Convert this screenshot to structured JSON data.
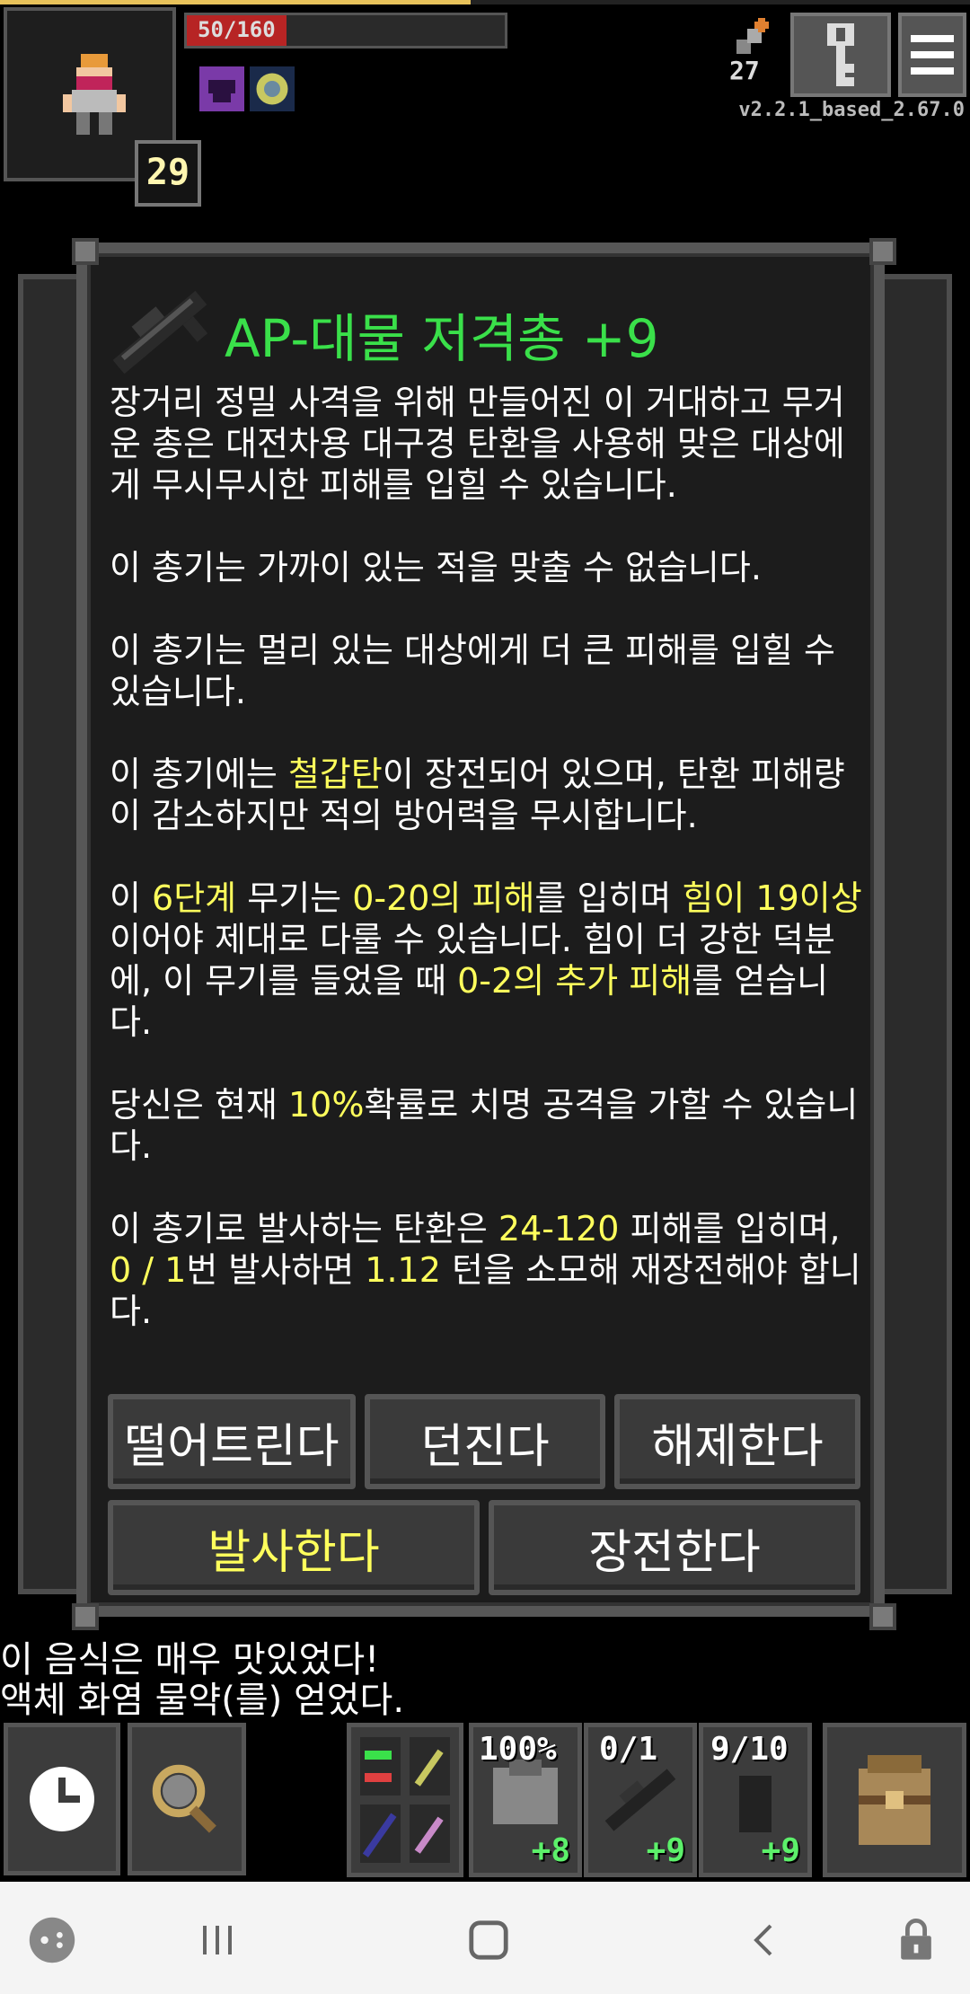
{
  "status": {
    "hp_text": "50/160",
    "hp_fraction": 0.3125,
    "level": "29",
    "depth": "27",
    "version": "v2.2.1_based_2.67.0",
    "xp_fraction": 0.485
  },
  "window": {
    "title": "AP-대물 저격총 +9",
    "p1": "장거리 정밀 사격을 위해 만들어진 이 거대하고 무거운 총은 대전차용 대구경 탄환을 사용해 맞은 대상에게 무시무시한 피해를 입힐 수 있습니다.",
    "p2": "이 총기는 가까이 있는 적을 맞출 수 없습니다.",
    "p3": "이 총기는 멀리 있는 대상에게 더 큰 피해를 입힐 수 있습니다.",
    "p4": {
      "a": "이 총기에는 ",
      "b": "철갑탄",
      "c": "이 장전되어 있으며, 탄환 피해량이 감소하지만 적의 방어력을 무시합니다."
    },
    "p5": {
      "a": "이 ",
      "b": "6단계",
      "c": " 무기는 ",
      "d": "0-20의 피해",
      "e": "를 입히며 ",
      "f": "힘이 19이상",
      "g": "이어야 제대로 다룰 수 있습니다. 힘이 더 강한 덕분에, 이 무기를 들었을 때 ",
      "h": "0-2의 추가 피해",
      "i": "를 얻습니다."
    },
    "p6": {
      "a": "당신은 현재 ",
      "b": "10%",
      "c": "확률로 치명 공격을 가할 수 있습니다."
    },
    "p7": {
      "a": "이 총기로 발사하는 탄환은 ",
      "b": "24-120",
      "c": " 피해를 입히며, ",
      "d": "0 / 1",
      "e": "번 발사하면 ",
      "f": "1.12",
      "g": " 턴을 소모해 재장전해야 합니다."
    },
    "buttons": {
      "drop": "떨어트린다",
      "throw": "던진다",
      "unequip": "해제한다",
      "fire": "발사한다",
      "reload": "장전한다"
    }
  },
  "log": {
    "line1": "이 음식은 매우 맛있었다!",
    "line2": "액체 화염 물약(를) 얻었다."
  },
  "quickslots": {
    "armor_pct": "100%",
    "armor_plus": "+8",
    "gun_ammo": "0/1",
    "gun_plus": "+9",
    "third": "9/10",
    "third_plus": "+9"
  },
  "colors": {
    "title": "#3ae04a",
    "highlight": "#ffff5c",
    "hp": "#b72424",
    "xp": "#e8c25a"
  },
  "icons": [
    "hero-icon",
    "buff-purple-icon",
    "buff-glow-icon",
    "depth-icon",
    "journal-key-icon",
    "menu-icon",
    "sniper-rifle-icon",
    "clock-icon",
    "search-icon",
    "swap-icon",
    "backpack-icon",
    "game-launcher-icon",
    "recents-icon",
    "home-icon",
    "back-icon",
    "lock-icon"
  ]
}
